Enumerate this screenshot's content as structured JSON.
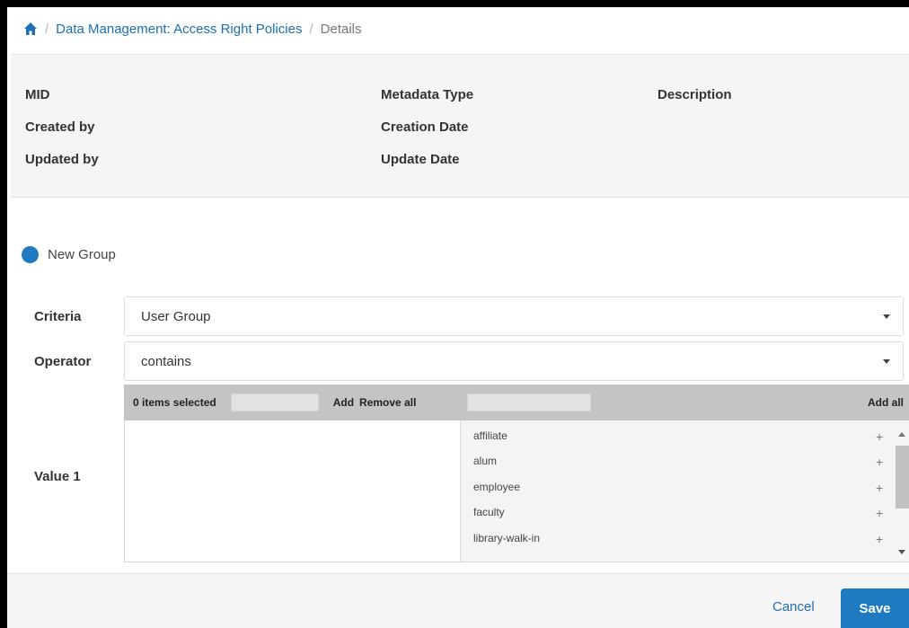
{
  "breadcrumb": {
    "home_icon": "home-icon",
    "separator": "/",
    "parent": "Data Management: Access Right Policies",
    "current": "Details"
  },
  "info": {
    "mid": "MID",
    "created_by": "Created by",
    "updated_by": "Updated by",
    "metadata_type": "Metadata Type",
    "creation_date": "Creation Date",
    "update_date": "Update Date",
    "description": "Description"
  },
  "group": {
    "name": "New Group",
    "dot_color": "#1f7bc1"
  },
  "form": {
    "criteria_label": "Criteria",
    "criteria_value": "User Group",
    "operator_label": "Operator",
    "operator_value": "contains",
    "value_label": "Value 1"
  },
  "value_selector": {
    "selected_count": "0 items selected",
    "add_label": "Add",
    "remove_all_label": "Remove all",
    "add_all_label": "Add all",
    "options": [
      "affiliate",
      "alum",
      "employee",
      "faculty",
      "library-walk-in"
    ],
    "add_symbol": "+"
  },
  "footer": {
    "cancel_label": "Cancel",
    "save_label": "Save"
  },
  "colors": {
    "accent": "#1f7bc1",
    "link": "#1a6fb5"
  }
}
